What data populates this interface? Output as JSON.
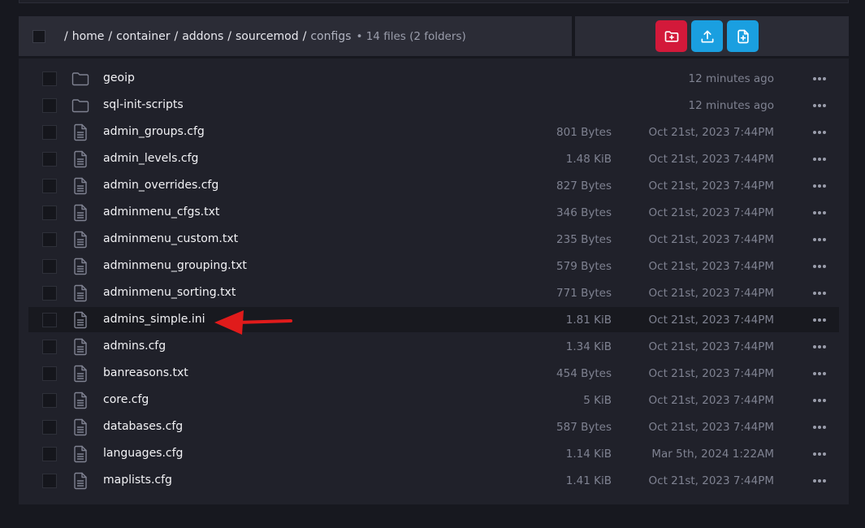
{
  "breadcrumb": {
    "segments": [
      "home",
      "container",
      "addons",
      "sourcemod"
    ],
    "current": "configs",
    "count": "• 14 files (2 folders)"
  },
  "actions": {
    "new_folder_icon": "folder-plus-icon",
    "upload_icon": "upload-icon",
    "new_file_icon": "file-plus-icon",
    "colors": {
      "new_folder": "#d3193a",
      "upload": "#1a9fe0",
      "new_file": "#1a9fe0"
    }
  },
  "files": [
    {
      "name": "geoip",
      "type": "folder",
      "size": "",
      "modified": "12 minutes ago"
    },
    {
      "name": "sql-init-scripts",
      "type": "folder",
      "size": "",
      "modified": "12 minutes ago"
    },
    {
      "name": "admin_groups.cfg",
      "type": "file",
      "size": "801 Bytes",
      "modified": "Oct 21st, 2023 7:44PM"
    },
    {
      "name": "admin_levels.cfg",
      "type": "file",
      "size": "1.48 KiB",
      "modified": "Oct 21st, 2023 7:44PM"
    },
    {
      "name": "admin_overrides.cfg",
      "type": "file",
      "size": "827 Bytes",
      "modified": "Oct 21st, 2023 7:44PM"
    },
    {
      "name": "adminmenu_cfgs.txt",
      "type": "file",
      "size": "346 Bytes",
      "modified": "Oct 21st, 2023 7:44PM"
    },
    {
      "name": "adminmenu_custom.txt",
      "type": "file",
      "size": "235 Bytes",
      "modified": "Oct 21st, 2023 7:44PM"
    },
    {
      "name": "adminmenu_grouping.txt",
      "type": "file",
      "size": "579 Bytes",
      "modified": "Oct 21st, 2023 7:44PM"
    },
    {
      "name": "adminmenu_sorting.txt",
      "type": "file",
      "size": "771 Bytes",
      "modified": "Oct 21st, 2023 7:44PM"
    },
    {
      "name": "admins_simple.ini",
      "type": "file",
      "size": "1.81 KiB",
      "modified": "Oct 21st, 2023 7:44PM",
      "highlighted": true
    },
    {
      "name": "admins.cfg",
      "type": "file",
      "size": "1.34 KiB",
      "modified": "Oct 21st, 2023 7:44PM"
    },
    {
      "name": "banreasons.txt",
      "type": "file",
      "size": "454 Bytes",
      "modified": "Oct 21st, 2023 7:44PM"
    },
    {
      "name": "core.cfg",
      "type": "file",
      "size": "5 KiB",
      "modified": "Oct 21st, 2023 7:44PM"
    },
    {
      "name": "databases.cfg",
      "type": "file",
      "size": "587 Bytes",
      "modified": "Oct 21st, 2023 7:44PM"
    },
    {
      "name": "languages.cfg",
      "type": "file",
      "size": "1.14 KiB",
      "modified": "Mar 5th, 2024 1:22AM"
    },
    {
      "name": "maplists.cfg",
      "type": "file",
      "size": "1.41 KiB",
      "modified": "Oct 21st, 2023 7:44PM"
    }
  ],
  "annotation": {
    "arrow_color": "#e01b1b",
    "arrow_icon": "red-arrow-icon"
  }
}
